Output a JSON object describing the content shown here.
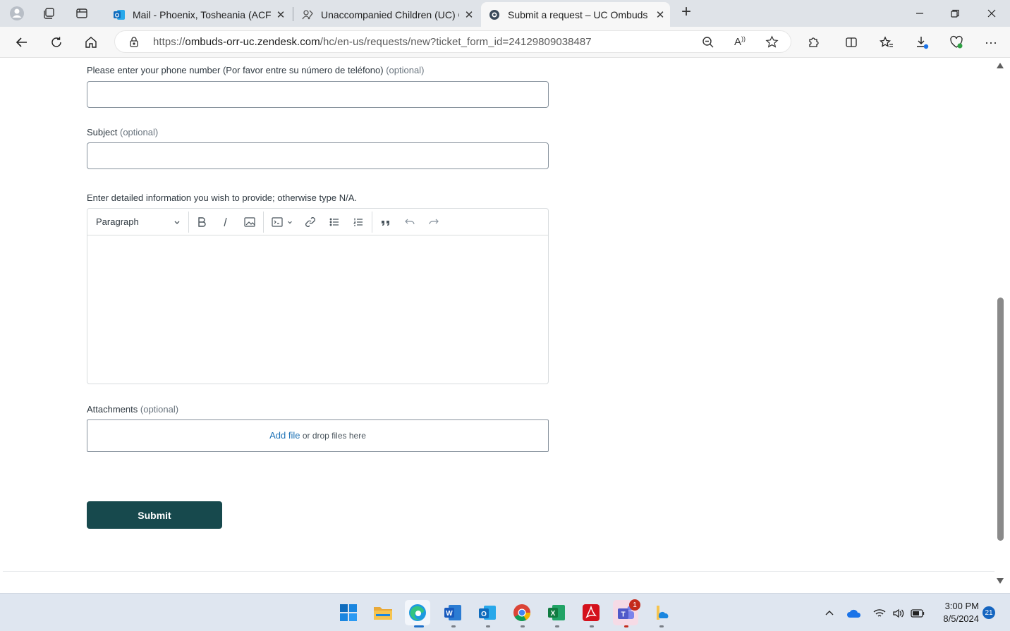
{
  "browser": {
    "tabs": [
      {
        "title": "Mail - Phoenix, Tosheania (ACF) (",
        "icon": "outlook-icon"
      },
      {
        "title": "Unaccompanied Children (UC) Of",
        "icon": "people-icon"
      },
      {
        "title": "Submit a request – UC Ombuds (",
        "icon": "zendesk-icon"
      }
    ],
    "url_prefix": "https://",
    "url_domain": "ombuds-orr-uc.zendesk.com",
    "url_path": "/hc/en-us/requests/new?ticket_form_id=24129809038487"
  },
  "form": {
    "phone_label": "Please enter your phone number (Por favor entre su número de teléfono)",
    "phone_optional": "(optional)",
    "subject_label": "Subject",
    "subject_optional": "(optional)",
    "details_label": "Enter detailed information you wish to provide; otherwise type N/A.",
    "editor_format": "Paragraph",
    "attachments_label": "Attachments",
    "attachments_optional": "(optional)",
    "add_file": "Add file",
    "drop_text": "or drop files here",
    "submit": "Submit"
  },
  "taskbar": {
    "time": "3:00 PM",
    "date": "8/5/2024",
    "notifications": "21",
    "teams_badge": "1"
  }
}
